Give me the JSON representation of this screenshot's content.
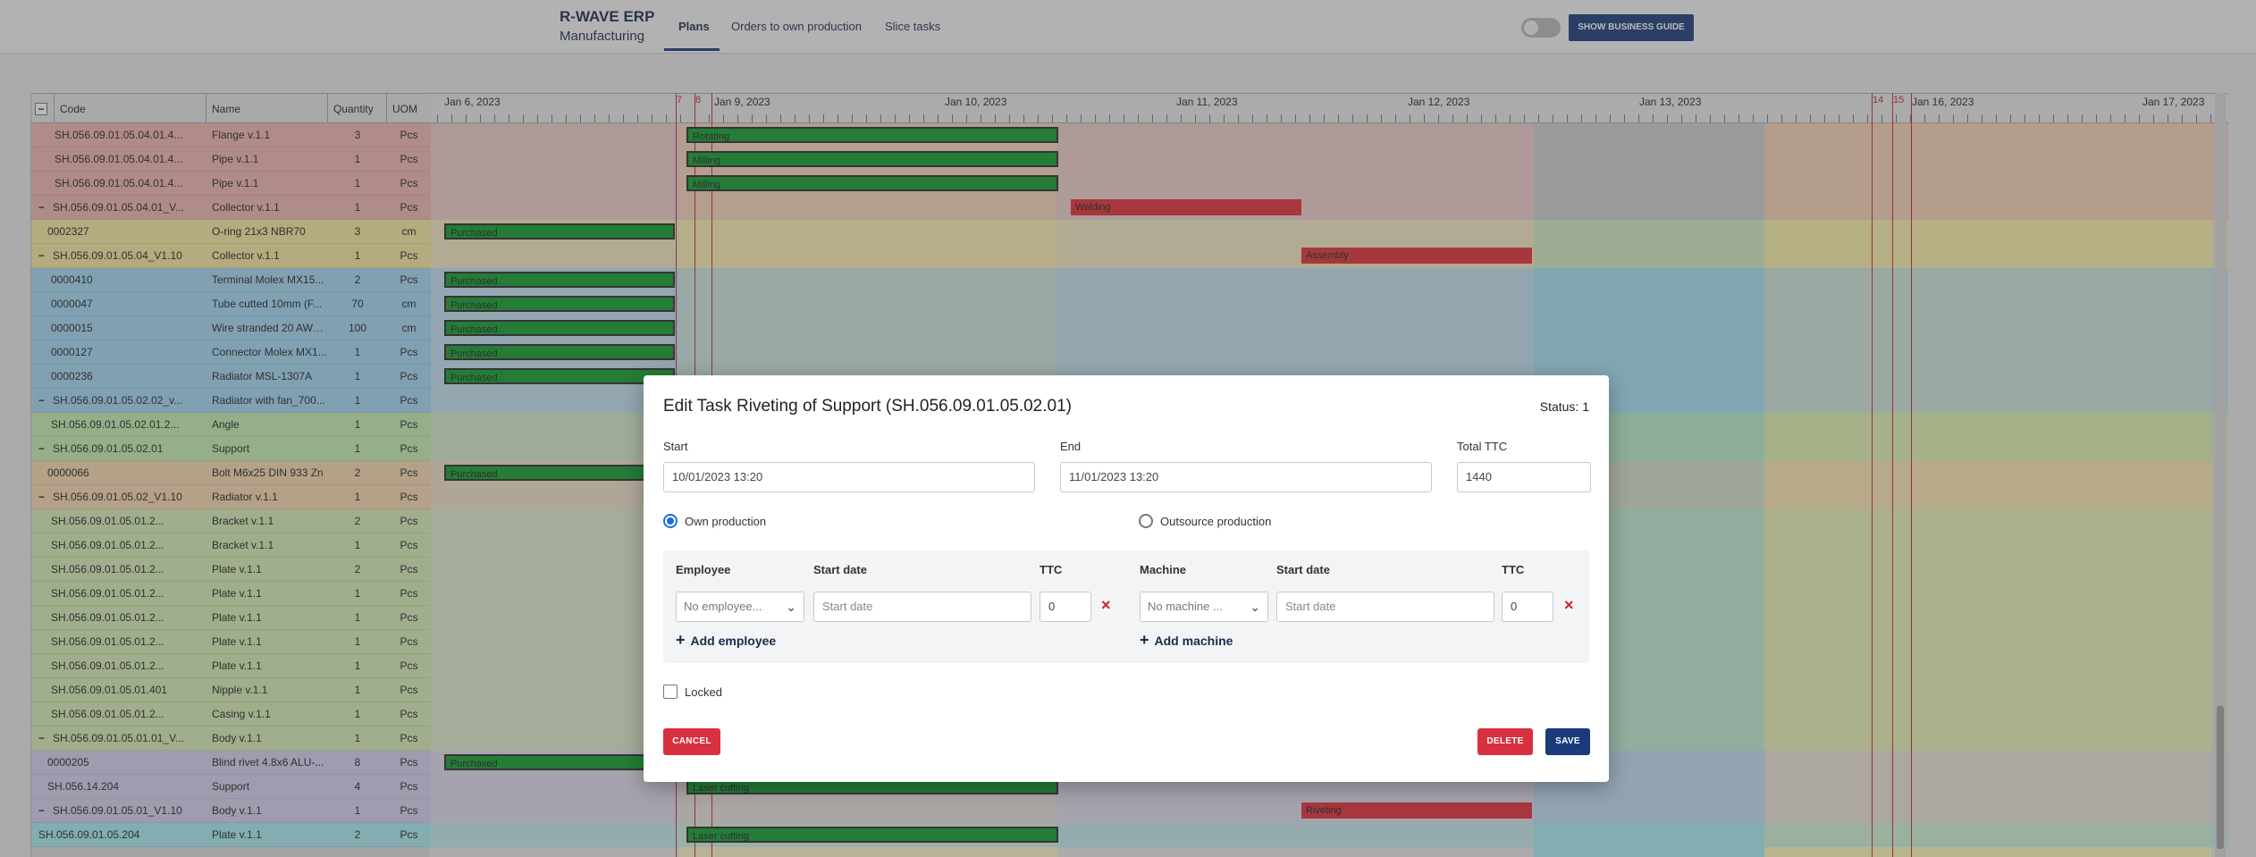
{
  "header": {
    "brand_title": "R-WAVE ERP",
    "brand_subtitle": "Manufacturing",
    "tabs": [
      {
        "label": "Plans",
        "active": true
      },
      {
        "label": "Orders to own production",
        "active": false
      },
      {
        "label": "Slice tasks",
        "active": false
      }
    ],
    "guide_button": "SHOW BUSINESS GUIDE",
    "accent_color": "#1b3a7a"
  },
  "table": {
    "collapse_symbol": "−",
    "columns": [
      "Code",
      "Name",
      "Quantity",
      "UOM"
    ],
    "rows": [
      {
        "code": "SH.056.09.01.05.04.01.4...",
        "name": "Flange v.1.1",
        "qty": "3",
        "uom": "Pcs",
        "minus": false,
        "color": "#f0b7b2"
      },
      {
        "code": "SH.056.09.01.05.04.01.4...",
        "name": "Pipe v.1.1",
        "qty": "1",
        "uom": "Pcs",
        "minus": false,
        "color": "#f0b7b2"
      },
      {
        "code": "SH.056.09.01.05.04.01.4...",
        "name": "Pipe v.1.1",
        "qty": "1",
        "uom": "Pcs",
        "minus": false,
        "color": "#f0b7b2"
      },
      {
        "code": "SH.056.09.01.05.04.01_V...",
        "name": "Collector v.1.1",
        "qty": "1",
        "uom": "Pcs",
        "minus": true,
        "color": "#f0b7b2"
      },
      {
        "code": "0002327",
        "name": "O-ring 21x3 NBR70",
        "qty": "3",
        "uom": "cm",
        "minus": false,
        "color": "#f7e9a0"
      },
      {
        "code": "SH.056.09.01.05.04_V1.10",
        "name": "Collector v.1.1",
        "qty": "1",
        "uom": "Pcs",
        "minus": true,
        "color": "#f7e9a0"
      },
      {
        "code": "0000410",
        "name": "Terminal Molex MX15...",
        "qty": "2",
        "uom": "Pcs",
        "minus": false,
        "color": "#a5d8f5"
      },
      {
        "code": "0000047",
        "name": "Tube cutted 10mm (F...",
        "qty": "70",
        "uom": "cm",
        "minus": false,
        "color": "#a5d8f5"
      },
      {
        "code": "0000015",
        "name": "Wire stranded 20 AWG...",
        "qty": "100",
        "uom": "cm",
        "minus": false,
        "color": "#a5d8f5"
      },
      {
        "code": "0000127",
        "name": "Connector Molex MX1...",
        "qty": "1",
        "uom": "Pcs",
        "minus": false,
        "color": "#a5d8f5"
      },
      {
        "code": "0000236",
        "name": "Radiator MSL-1307A",
        "qty": "1",
        "uom": "Pcs",
        "minus": false,
        "color": "#a5d8f5"
      },
      {
        "code": "SH.056.09.01.05.02.02_v...",
        "name": "Radiator with fan_700...",
        "qty": "1",
        "uom": "Pcs",
        "minus": true,
        "color": "#a5d8f5"
      },
      {
        "code": "SH.056.09.01.05.02.01.2...",
        "name": "Angle",
        "qty": "1",
        "uom": "Pcs",
        "minus": false,
        "color": "#c6efb0"
      },
      {
        "code": "SH.056.09.01.05.02.01",
        "name": "Support",
        "qty": "1",
        "uom": "Pcs",
        "minus": true,
        "color": "#c6efb0"
      },
      {
        "code": "0000066",
        "name": "Bolt M6x25 DIN 933 Zn",
        "qty": "2",
        "uom": "Pcs",
        "minus": false,
        "color": "#f7d9b0"
      },
      {
        "code": "SH.056.09.01.05.02_V1.10",
        "name": "Radiator v.1.1",
        "qty": "1",
        "uom": "Pcs",
        "minus": true,
        "color": "#f7d9b0"
      },
      {
        "code": "SH.056.09.01.05.01.2...",
        "name": "Bracket v.1.1",
        "qty": "2",
        "uom": "Pcs",
        "minus": false,
        "color": "#d7edb6"
      },
      {
        "code": "SH.056.09.01.05.01.2...",
        "name": "Bracket v.1.1",
        "qty": "1",
        "uom": "Pcs",
        "minus": false,
        "color": "#d7edb6"
      },
      {
        "code": "SH.056.09.01.05.01.2...",
        "name": "Plate v.1.1",
        "qty": "2",
        "uom": "Pcs",
        "minus": false,
        "color": "#d7edb6"
      },
      {
        "code": "SH.056.09.01.05.01.2...",
        "name": "Plate v.1.1",
        "qty": "1",
        "uom": "Pcs",
        "minus": false,
        "color": "#d7edb6"
      },
      {
        "code": "SH.056.09.01.05.01.2...",
        "name": "Plate v.1.1",
        "qty": "1",
        "uom": "Pcs",
        "minus": false,
        "color": "#d7edb6"
      },
      {
        "code": "SH.056.09.01.05.01.2...",
        "name": "Plate v.1.1",
        "qty": "1",
        "uom": "Pcs",
        "minus": false,
        "color": "#d7edb6"
      },
      {
        "code": "SH.056.09.01.05.01.2...",
        "name": "Plate v.1.1",
        "qty": "1",
        "uom": "Pcs",
        "minus": false,
        "color": "#d7edb6"
      },
      {
        "code": "SH.056.09.01.05.01.401",
        "name": "Nipple v.1.1",
        "qty": "1",
        "uom": "Pcs",
        "minus": false,
        "color": "#d7edb6"
      },
      {
        "code": "SH.056.09.01.05.01.2...",
        "name": "Casing v.1.1",
        "qty": "1",
        "uom": "Pcs",
        "minus": false,
        "color": "#d7edb6"
      },
      {
        "code": "SH.056.09.01.05.01.01_V...",
        "name": "Body v.1.1",
        "qty": "1",
        "uom": "Pcs",
        "minus": true,
        "color": "#d7edb6"
      },
      {
        "code": "0000205",
        "name": "Blind rivet 4.8x6 ALU-...",
        "qty": "8",
        "uom": "Pcs",
        "minus": false,
        "color": "#d8cff0"
      },
      {
        "code": "SH.056.14.204",
        "name": "Support",
        "qty": "4",
        "uom": "Pcs",
        "minus": false,
        "color": "#d8cff0"
      },
      {
        "code": "SH.056.09.01.05.01_V1.10",
        "name": "Body v.1.1",
        "qty": "1",
        "uom": "Pcs",
        "minus": true,
        "color": "#d8cff0"
      },
      {
        "code": "SH.056.09.01.05.204",
        "name": "Plate v.1.1",
        "qty": "2",
        "uom": "Pcs",
        "minus": false,
        "color": "#a8ecf0"
      }
    ]
  },
  "gantt": {
    "date_labels": [
      "Jan 6, 2023",
      "Jan 9, 2023",
      "Jan 10, 2023",
      "Jan 11, 2023",
      "Jan 12, 2023",
      "Jan 13, 2023",
      "Jan 16, 2023",
      "Jan 17, 2023"
    ],
    "marker_labels": [
      "7",
      "8",
      "14",
      "15"
    ],
    "bar_labels": [
      "Rotating",
      "Milling",
      "Milling",
      "Welding",
      "Purchased",
      "Assembly",
      "Purchased",
      "Purchased",
      "Purchased",
      "Purchased",
      "Purchased",
      "Purchased",
      "Purchased",
      "Laser cutting",
      "Riveting",
      "Laser cutting"
    ],
    "band_colors": [
      "#fdf7c8",
      "#a7ecf3",
      "#fff9b8"
    ]
  },
  "modal": {
    "title": "Edit Task Riveting of Support (SH.056.09.01.05.02.01)",
    "status": "Status: 1",
    "start_label": "Start",
    "start_value": "10/01/2023 13:20",
    "end_label": "End",
    "end_value": "11/01/2023 13:20",
    "ttc_label": "Total TTC",
    "ttc_value": "1440",
    "radio_own": "Own production",
    "radio_outsource": "Outsource production",
    "employee_header": "Employee",
    "emp_start_header": "Start date",
    "emp_ttc_header": "TTC",
    "machine_header": "Machine",
    "mach_start_header": "Start date",
    "mach_ttc_header": "TTC",
    "employee_select": "No employee...",
    "emp_start_placeholder": "Start date",
    "emp_ttc_value": "0",
    "machine_select": "No machine ...",
    "mach_start_placeholder": "Start date",
    "mach_ttc_value": "0",
    "add_employee": "Add employee",
    "add_machine": "Add machine",
    "locked_label": "Locked",
    "cancel": "CANCEL",
    "delete": "DELETE",
    "save": "SAVE",
    "remove_symbol": "×",
    "dropdown_symbol": "⌄",
    "add_symbol": "+"
  }
}
